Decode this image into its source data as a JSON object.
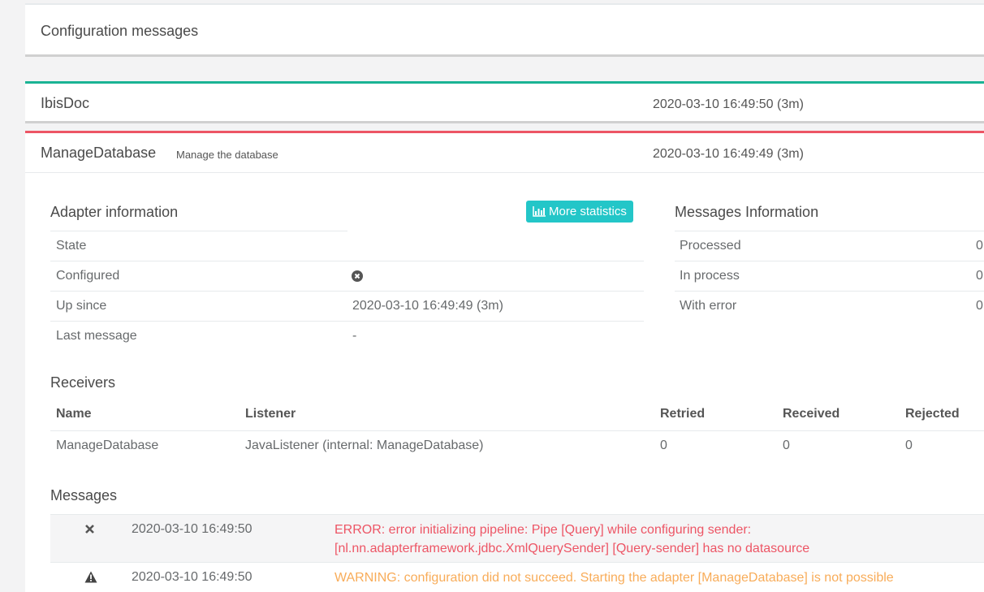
{
  "config_panel": {
    "title": "Configuration messages"
  },
  "ibisdoc": {
    "title": "IbisDoc",
    "time": "2020-03-10 16:49:50 (3m)"
  },
  "manage": {
    "title": "ManageDatabase",
    "description": "Manage the database",
    "time": "2020-03-10 16:49:49 (3m)",
    "adapter_info": {
      "heading": "Adapter information",
      "more_stats_label": "More statistics",
      "rows": [
        {
          "label": "State",
          "value": ""
        },
        {
          "label": "Configured",
          "value": ""
        },
        {
          "label": "Up since",
          "value": "2020-03-10 16:49:49 (3m)"
        },
        {
          "label": "Last message",
          "value": "-"
        }
      ]
    },
    "messages_info": {
      "heading": "Messages Information",
      "rows": [
        {
          "label": "Processed",
          "value": "0"
        },
        {
          "label": "In process",
          "value": "0"
        },
        {
          "label": "With error",
          "value": "0"
        }
      ]
    },
    "receivers": {
      "heading": "Receivers",
      "columns": [
        "Name",
        "Listener",
        "Retried",
        "Received",
        "Rejected"
      ],
      "rows": [
        {
          "name": "ManageDatabase",
          "listener": "JavaListener (internal: ManageDatabase)",
          "retried": "0",
          "received": "0",
          "rejected": "0"
        }
      ]
    },
    "messages": {
      "heading": "Messages",
      "items": [
        {
          "icon": "close-icon",
          "time": "2020-03-10 16:49:50",
          "line1": "ERROR: error initializing pipeline: Pipe [Query] while configuring sender:",
          "line2": "[nl.nn.adapterframework.jdbc.XmlQuerySender] [Query-sender] has no datasource"
        },
        {
          "icon": "warning-icon",
          "time": "2020-03-10 16:49:50",
          "line1": "WARNING: configuration did not succeed. Starting the adapter [ManageDatabase] is not possible"
        }
      ]
    }
  },
  "colors": {
    "accent_green": "#1ab394",
    "accent_red": "#ed5565",
    "button_cyan": "#23c6c8",
    "warning": "#f8ac59"
  }
}
